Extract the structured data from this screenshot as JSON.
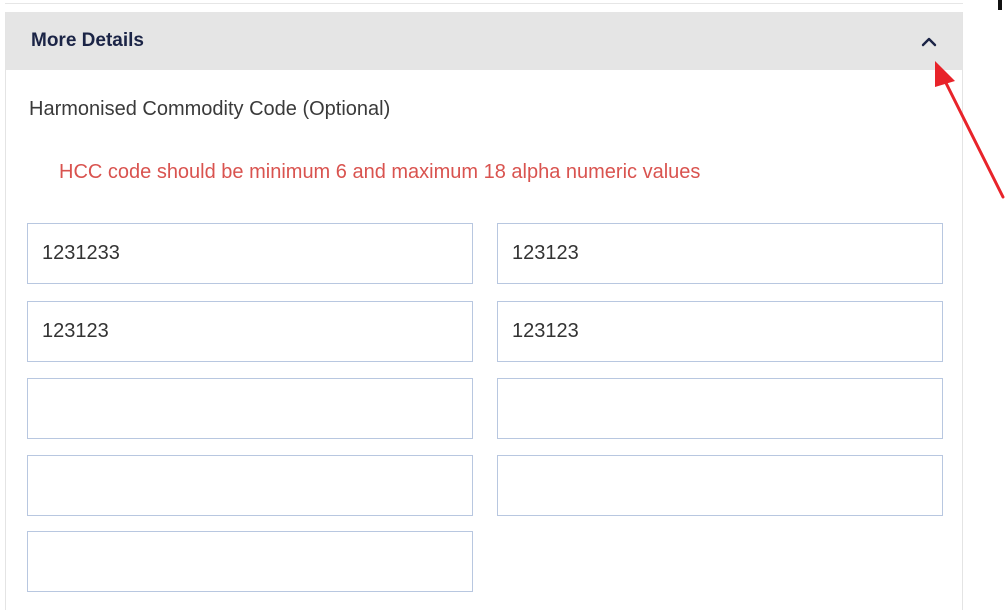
{
  "panel": {
    "title": "More Details",
    "collapse_icon": "chevron-up-icon",
    "field_label": "Harmonised Commodity Code (Optional)",
    "error_message": "HCC code should be minimum 6 and maximum 18 alpha numeric values",
    "hcc_inputs": [
      {
        "value": "1231233"
      },
      {
        "value": "123123"
      },
      {
        "value": "123123"
      },
      {
        "value": "123123"
      },
      {
        "value": ""
      },
      {
        "value": ""
      },
      {
        "value": ""
      },
      {
        "value": ""
      },
      {
        "value": ""
      }
    ]
  },
  "colors": {
    "header_background": "#e5e5e5",
    "title_text": "#1b2446",
    "error_text": "#d9534f",
    "input_border": "#b8c7e0",
    "annotation_arrow": "#e8232a"
  }
}
